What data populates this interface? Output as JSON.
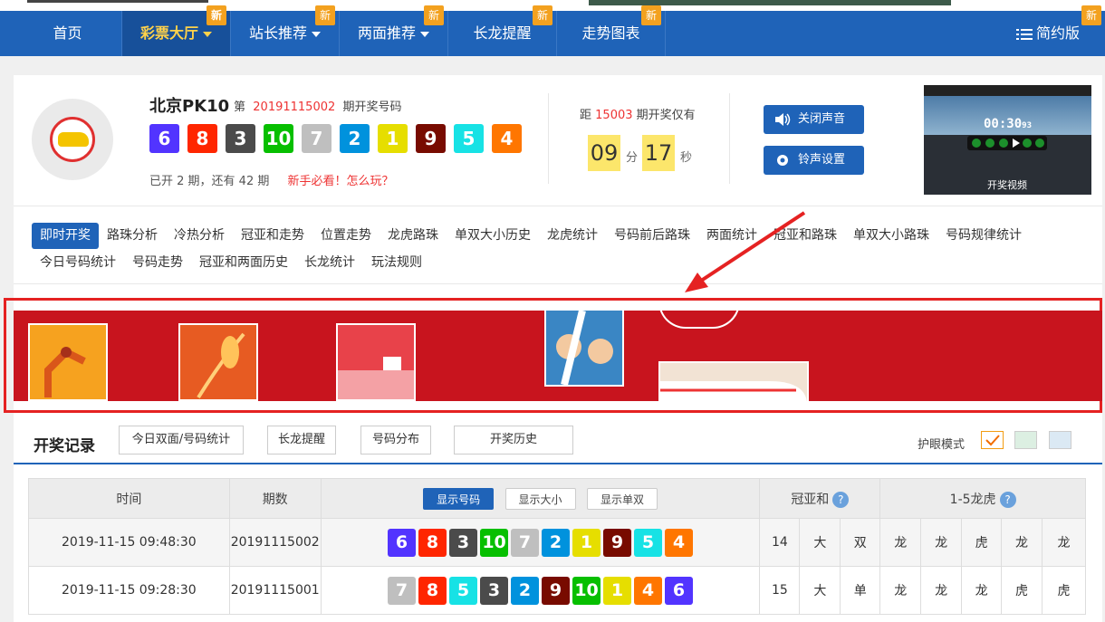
{
  "nav": {
    "items": [
      {
        "label": "首页",
        "badge": "",
        "caret": false,
        "active": false
      },
      {
        "label": "彩票大厅",
        "badge": "新",
        "caret": true,
        "active": true
      },
      {
        "label": "站长推荐",
        "badge": "新",
        "caret": true,
        "active": false
      },
      {
        "label": "两面推荐",
        "badge": "新",
        "caret": true,
        "active": false
      },
      {
        "label": "长龙提醒",
        "badge": "新",
        "caret": false,
        "active": false
      },
      {
        "label": "走势图表",
        "badge": "新",
        "caret": false,
        "active": false
      }
    ],
    "simple_label": "简约版",
    "simple_badge": "新"
  },
  "game": {
    "title": "北京PK10",
    "issue_prefix": "第",
    "issue": "20191115002",
    "issue_suffix": "期开奖号码",
    "balls": [
      6,
      8,
      3,
      10,
      7,
      2,
      1,
      9,
      5,
      4
    ],
    "status": "已开 2 期，还有 42 期",
    "newbie_link": "新手必看！怎么玩？"
  },
  "countdown": {
    "prefix": "距",
    "issue": "15003",
    "suffix": "期开奖仅有",
    "minutes": "09",
    "minutes_unit": "分",
    "seconds": "17",
    "seconds_unit": "秒"
  },
  "buttons": {
    "mute": "关闭声音",
    "ringtone": "铃声设置"
  },
  "video": {
    "timer": "00:30",
    "timer_small": "93",
    "caption": "开奖视频"
  },
  "tabs": [
    "即时开奖",
    "路珠分析",
    "冷热分析",
    "冠亚和走势",
    "位置走势",
    "龙虎路珠",
    "单双大小历史",
    "龙虎统计",
    "号码前后路珠",
    "两面统计",
    "冠亚和路珠",
    "单双大小路珠",
    "号码规律统计",
    "今日号码统计",
    "号码走势",
    "冠亚和两面历史",
    "长龙统计",
    "玩法规则"
  ],
  "records": {
    "title": "开奖记录",
    "buttons": [
      "今日双面/号码统计",
      "长龙提醒",
      "号码分布",
      "开奖历史"
    ],
    "eye_mode": "护眼模式"
  },
  "table": {
    "headers": {
      "time": "时间",
      "issue": "期数",
      "sum": "冠亚和",
      "dragon": "1-5龙虎",
      "help": "?"
    },
    "switches": [
      "显示号码",
      "显示大小",
      "显示单双"
    ],
    "rows": [
      {
        "time": "2019-11-15 09:48:30",
        "issue": "20191115002",
        "balls": [
          6,
          8,
          3,
          10,
          7,
          2,
          1,
          9,
          5,
          4
        ],
        "sum": "14",
        "size": "大",
        "parity": "双",
        "dt": [
          "龙",
          "龙",
          "虎",
          "龙",
          "龙"
        ]
      },
      {
        "time": "2019-11-15 09:28:30",
        "issue": "20191115001",
        "balls": [
          7,
          8,
          5,
          3,
          2,
          9,
          10,
          1,
          4,
          6
        ],
        "sum": "15",
        "size": "大",
        "parity": "单",
        "dt": [
          "龙",
          "龙",
          "龙",
          "虎",
          "虎"
        ]
      }
    ]
  },
  "colors": {
    "ball_1": "#e6de00",
    "ball_2": "#0092dd",
    "ball_3": "#4b4b4b",
    "ball_4": "#ff7600",
    "ball_5": "#17e2e5",
    "ball_6": "#5234ff",
    "ball_7": "#bfbfbf",
    "ball_8": "#ff2600",
    "ball_9": "#780b00",
    "ball_10": "#07bf00",
    "nav": "#1f63b8",
    "badge": "#f3a11f"
  }
}
